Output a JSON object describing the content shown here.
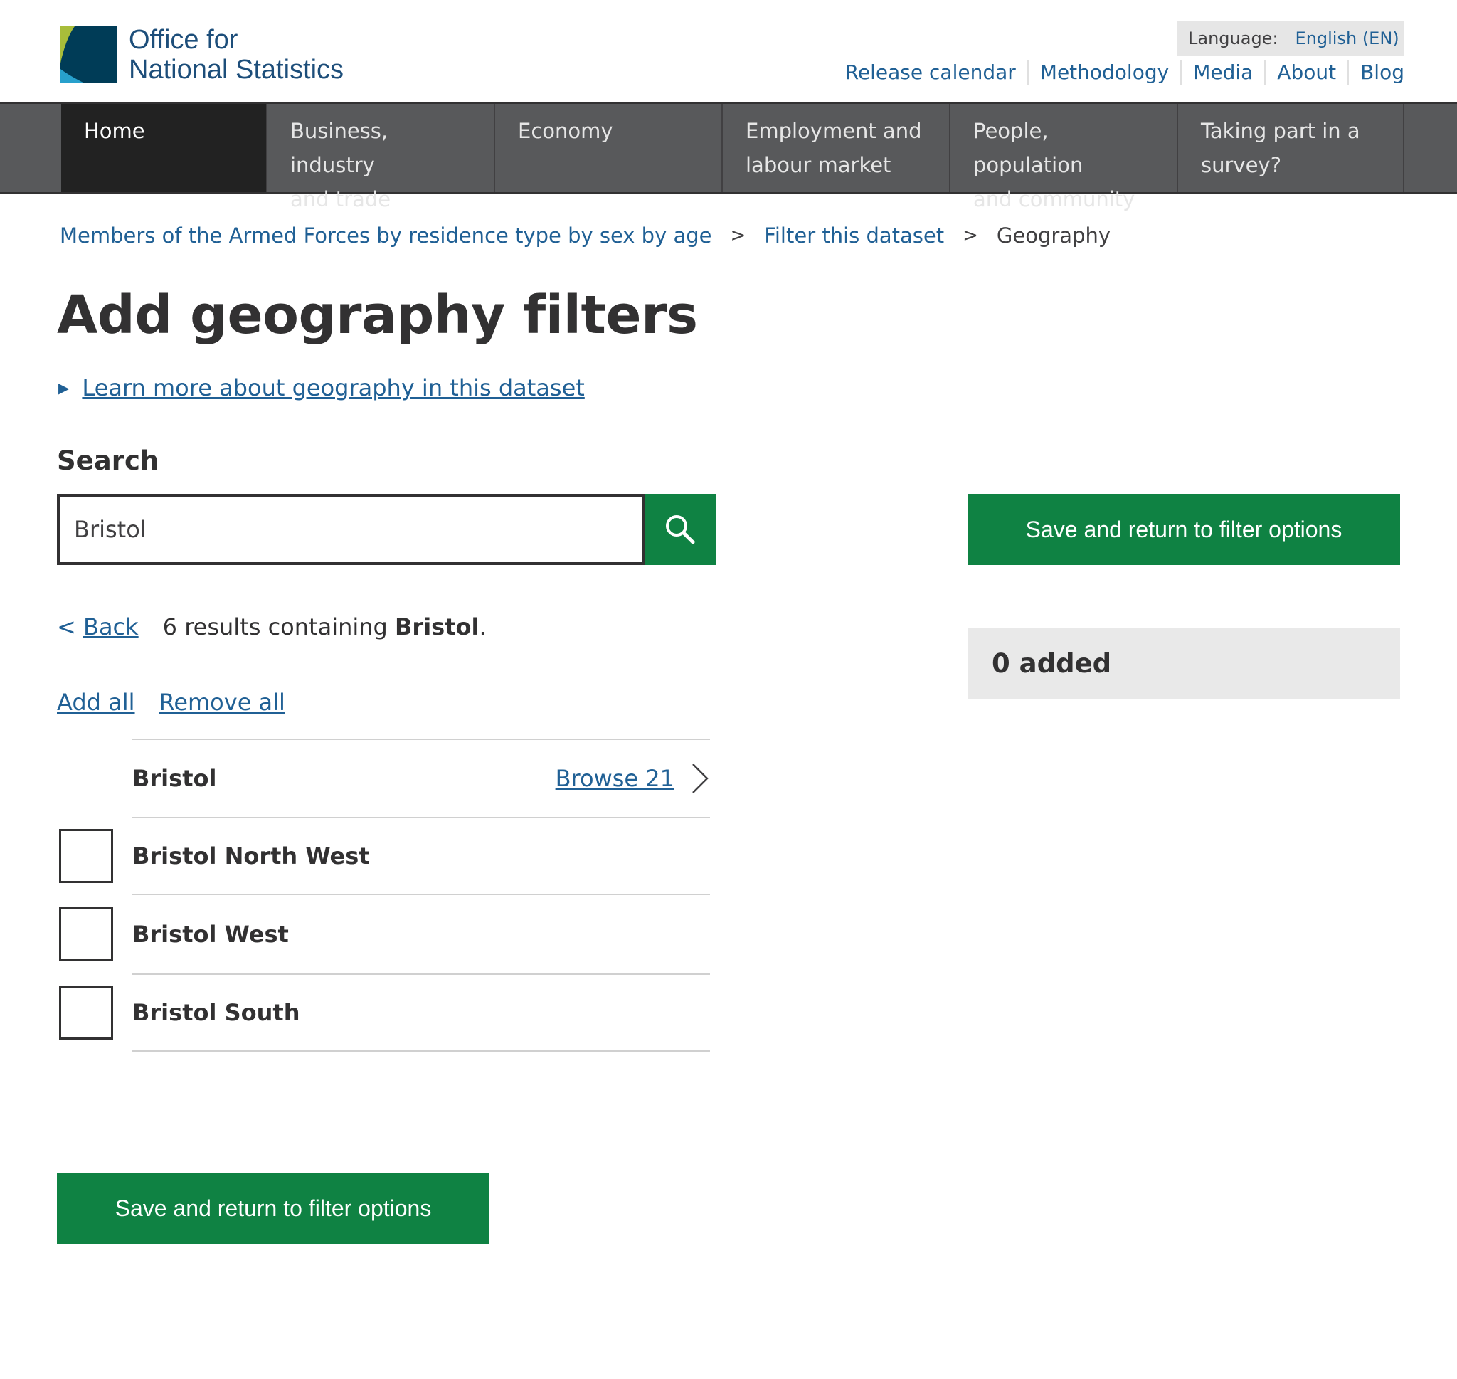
{
  "header": {
    "logo_line1": "Office for",
    "logo_line2": "National Statistics",
    "language_label": "Language:",
    "language_value": "English (EN)",
    "links": [
      "Release calendar",
      "Methodology",
      "Media",
      "About",
      "Blog"
    ]
  },
  "nav": {
    "items": [
      {
        "line1": "Home",
        "line2": ""
      },
      {
        "line1": "Business, industry",
        "line2": "and trade"
      },
      {
        "line1": "Economy",
        "line2": ""
      },
      {
        "line1": "Employment and",
        "line2": "labour market"
      },
      {
        "line1": "People, population",
        "line2": "and community"
      },
      {
        "line1": "Taking part in a",
        "line2": "survey?"
      }
    ],
    "active_index": 0
  },
  "breadcrumb": {
    "items": [
      "Members of the Armed Forces by residence type by sex by age",
      "Filter this dataset"
    ],
    "current": "Geography",
    "separator": ">"
  },
  "page_title": "Add geography filters",
  "details_link": "Learn more about geography in this dataset",
  "search": {
    "label": "Search",
    "value": "Bristol"
  },
  "save_label": "Save and return to filter options",
  "added_label": "0 added",
  "results": {
    "back_prefix": "<",
    "back_label": "Back",
    "summary_prefix": "6 results containing ",
    "summary_term": "Bristol",
    "summary_suffix": "."
  },
  "bulk": {
    "add_all": "Add all",
    "remove_all": "Remove all"
  },
  "list": {
    "parent": {
      "label": "Bristol",
      "browse_label": "Browse 21"
    },
    "items": [
      {
        "label": "Bristol North West",
        "checked": false
      },
      {
        "label": "Bristol West",
        "checked": false
      },
      {
        "label": "Bristol South",
        "checked": false
      }
    ]
  },
  "colors": {
    "brand_blue": "#206095",
    "button_green": "#0f8243",
    "nav_grey": "#58595b",
    "nav_active": "#222222",
    "logo_green": "#a8bd3a",
    "logo_navy": "#003c57"
  }
}
